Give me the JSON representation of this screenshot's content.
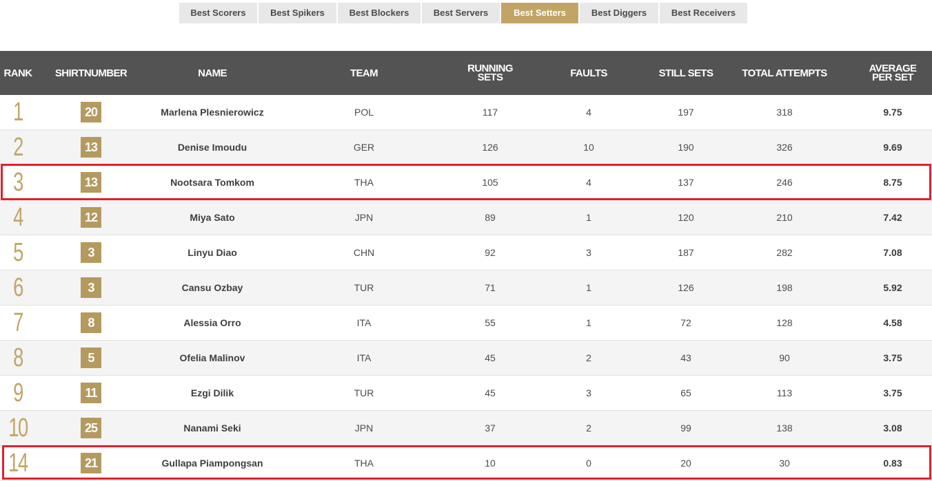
{
  "tabs": [
    {
      "label": "Best Scorers",
      "active": false
    },
    {
      "label": "Best Spikers",
      "active": false
    },
    {
      "label": "Best Blockers",
      "active": false
    },
    {
      "label": "Best Servers",
      "active": false
    },
    {
      "label": "Best Setters",
      "active": true
    },
    {
      "label": "Best Diggers",
      "active": false
    },
    {
      "label": "Best Receivers",
      "active": false
    }
  ],
  "columns": {
    "rank": "RANK",
    "shirt": "SHIRTNUMBER",
    "name": "NAME",
    "team": "TEAM",
    "running_sets": "RUNNING SETS",
    "faults": "FAULTS",
    "still_sets": "STILL SETS",
    "total_attempts": "TOTAL ATTEMPTS",
    "average": "AVERAGE PER SET"
  },
  "rows": [
    {
      "rank": "1",
      "shirt": "20",
      "name": "Marlena Plesnierowicz",
      "team": "POL",
      "running_sets": "117",
      "faults": "4",
      "still_sets": "197",
      "total_attempts": "318",
      "average": "9.75"
    },
    {
      "rank": "2",
      "shirt": "13",
      "name": "Denise Imoudu",
      "team": "GER",
      "running_sets": "126",
      "faults": "10",
      "still_sets": "190",
      "total_attempts": "326",
      "average": "9.69"
    },
    {
      "rank": "3",
      "shirt": "13",
      "name": "Nootsara Tomkom",
      "team": "THA",
      "running_sets": "105",
      "faults": "4",
      "still_sets": "137",
      "total_attempts": "246",
      "average": "8.75"
    },
    {
      "rank": "4",
      "shirt": "12",
      "name": "Miya Sato",
      "team": "JPN",
      "running_sets": "89",
      "faults": "1",
      "still_sets": "120",
      "total_attempts": "210",
      "average": "7.42"
    },
    {
      "rank": "5",
      "shirt": "3",
      "name": "Linyu Diao",
      "team": "CHN",
      "running_sets": "92",
      "faults": "3",
      "still_sets": "187",
      "total_attempts": "282",
      "average": "7.08"
    },
    {
      "rank": "6",
      "shirt": "3",
      "name": "Cansu Ozbay",
      "team": "TUR",
      "running_sets": "71",
      "faults": "1",
      "still_sets": "126",
      "total_attempts": "198",
      "average": "5.92"
    },
    {
      "rank": "7",
      "shirt": "8",
      "name": "Alessia Orro",
      "team": "ITA",
      "running_sets": "55",
      "faults": "1",
      "still_sets": "72",
      "total_attempts": "128",
      "average": "4.58"
    },
    {
      "rank": "8",
      "shirt": "5",
      "name": "Ofelia Malinov",
      "team": "ITA",
      "running_sets": "45",
      "faults": "2",
      "still_sets": "43",
      "total_attempts": "90",
      "average": "3.75"
    },
    {
      "rank": "9",
      "shirt": "11",
      "name": "Ezgi Dilik",
      "team": "TUR",
      "running_sets": "45",
      "faults": "3",
      "still_sets": "65",
      "total_attempts": "113",
      "average": "3.75"
    },
    {
      "rank": "10",
      "shirt": "25",
      "name": "Nanami Seki",
      "team": "JPN",
      "running_sets": "37",
      "faults": "2",
      "still_sets": "99",
      "total_attempts": "138",
      "average": "3.08"
    },
    {
      "rank": "14",
      "shirt": "21",
      "name": "Gullapa Piampongsan",
      "team": "THA",
      "running_sets": "10",
      "faults": "0",
      "still_sets": "20",
      "total_attempts": "30",
      "average": "0.83"
    }
  ],
  "colors": {
    "accent": "#c2a566",
    "header_bg": "#535353",
    "highlight": "#e0202a"
  }
}
